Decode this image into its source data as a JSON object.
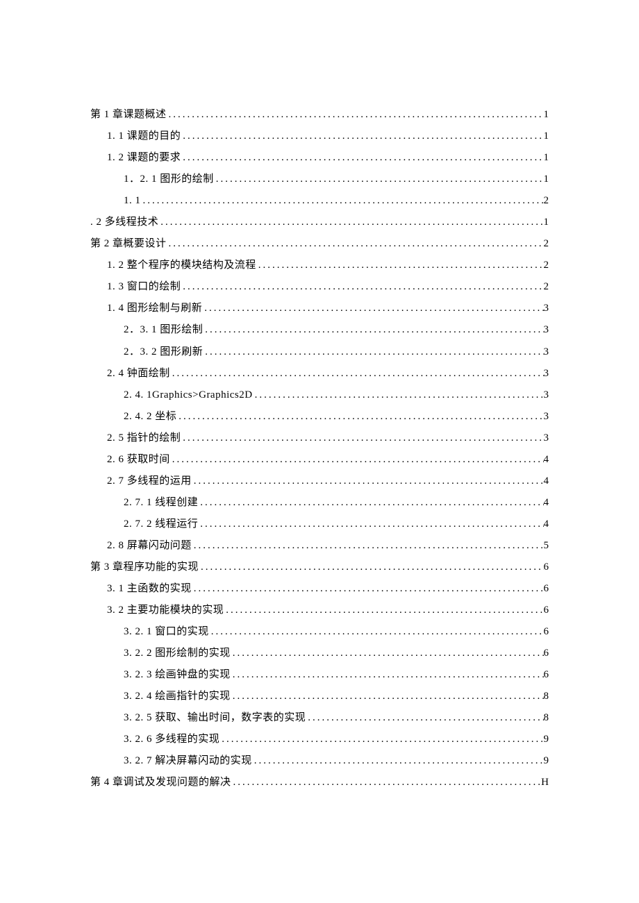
{
  "toc": [
    {
      "level": 0,
      "title": "第 1 章课题概述",
      "page": "1"
    },
    {
      "level": 1,
      "title": "1. 1 课题的目的",
      "page": "1"
    },
    {
      "level": 1,
      "title": "1. 2 课题的要求",
      "page": "1"
    },
    {
      "level": 2,
      "title": "1．2. 1 图形的绘制",
      "page": "1"
    },
    {
      "level": 2,
      "title": "1. 1",
      "page": "2"
    },
    {
      "level": 0,
      "title": ". 2 多线程技术",
      "page": "1"
    },
    {
      "level": 0,
      "title": "第 2 章概要设计",
      "page": "2"
    },
    {
      "level": 1,
      "title": "1. 2 整个程序的模块结构及流程",
      "page": "2"
    },
    {
      "level": 1,
      "title": "1. 3  窗口的绘制",
      "page": "2"
    },
    {
      "level": 1,
      "title": "1. 4  图形绘制与刷新",
      "page": "3"
    },
    {
      "level": 2,
      "title": "2．3. 1 图形绘制",
      "page": "3"
    },
    {
      "level": 2,
      "title": "2．3. 2 图形刷新",
      "page": "3"
    },
    {
      "level": 1,
      "title": "2. 4 钟面绘制",
      "page": "3"
    },
    {
      "level": 2,
      "title": "2. 4. 1Graphics>Graphics2D",
      "page": "3"
    },
    {
      "level": 2,
      "title": "2. 4. 2 坐标",
      "page": "3"
    },
    {
      "level": 1,
      "title": "2. 5  指针的绘制",
      "page": "3"
    },
    {
      "level": 1,
      "title": "2. 6  获取时间",
      "page": "4"
    },
    {
      "level": 1,
      "title": "2. 7  多线程的运用",
      "page": "4"
    },
    {
      "level": 2,
      "title": "2. 7. 1 线程创建",
      "page": "4"
    },
    {
      "level": 2,
      "title": "2. 7. 2 线程运行",
      "page": "4"
    },
    {
      "level": 1,
      "title": "2. 8 屏幕闪动问题",
      "page": "5"
    },
    {
      "level": 0,
      "title": "第 3 章程序功能的实现",
      "page": "6"
    },
    {
      "level": 1,
      "title": "3. 1 主函数的实现",
      "page": "6"
    },
    {
      "level": 1,
      "title": "3. 2  主要功能模块的实现",
      "page": "6"
    },
    {
      "level": 2,
      "title": "3. 2. 1 窗口的实现",
      "page": "6"
    },
    {
      "level": 2,
      "title": "3. 2. 2 图形绘制的实现",
      "page": "6"
    },
    {
      "level": 2,
      "title": "3. 2. 3 绘画钟盘的实现",
      "page": "6"
    },
    {
      "level": 2,
      "title": "3. 2. 4 绘画指针的实现",
      "page": "8"
    },
    {
      "level": 2,
      "title": "3. 2. 5 获取、输出时间，数字表的实现",
      "page": "8"
    },
    {
      "level": 2,
      "title": "3. 2. 6 多线程的实现",
      "page": "9"
    },
    {
      "level": 2,
      "title": "3. 2. 7 解决屏幕闪动的实现",
      "page": "9"
    },
    {
      "level": 0,
      "title": "第 4 章调试及发现问题的解决",
      "page": "H"
    }
  ]
}
